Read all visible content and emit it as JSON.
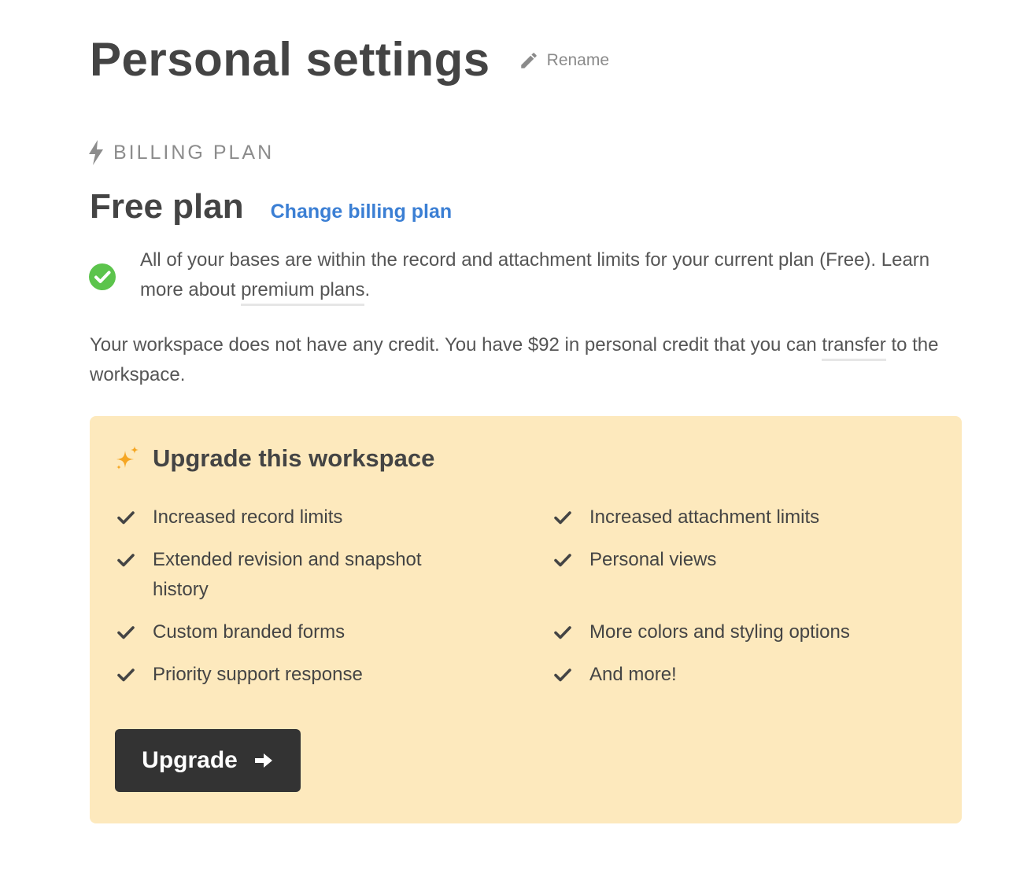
{
  "header": {
    "title": "Personal settings",
    "rename_label": "Rename"
  },
  "billing": {
    "section_label": "BILLING PLAN",
    "plan_name": "Free plan",
    "change_plan_label": "Change billing plan",
    "status_message_part1": "All of your bases are within the record and attachment limits for your current plan (Free). Learn more about ",
    "status_link": "premium plans",
    "status_message_part2": ".",
    "credit_message_part1": "Your workspace does not have any credit. You have $92 in personal credit that you can ",
    "credit_link": "transfer",
    "credit_message_part2": " to the workspace."
  },
  "upgrade": {
    "title": "Upgrade this workspace",
    "features": [
      "Increased record limits",
      "Increased attachment limits",
      "Extended revision and snapshot history",
      "Personal views",
      "Custom branded forms",
      "More colors and styling options",
      "Priority support response",
      "And more!"
    ],
    "button_label": "Upgrade"
  },
  "colors": {
    "link_blue": "#3b7fd4",
    "success_green": "#5cc44c",
    "card_background": "#fde9bd",
    "button_dark": "#333333",
    "sparkle_orange": "#f5a623"
  },
  "icons": {
    "rename": "pencil-icon",
    "section": "lightning-bolt-icon",
    "status": "check-circle-icon",
    "upgrade_header": "sparkle-icon",
    "feature": "checkmark-icon",
    "button": "arrow-right-icon"
  }
}
